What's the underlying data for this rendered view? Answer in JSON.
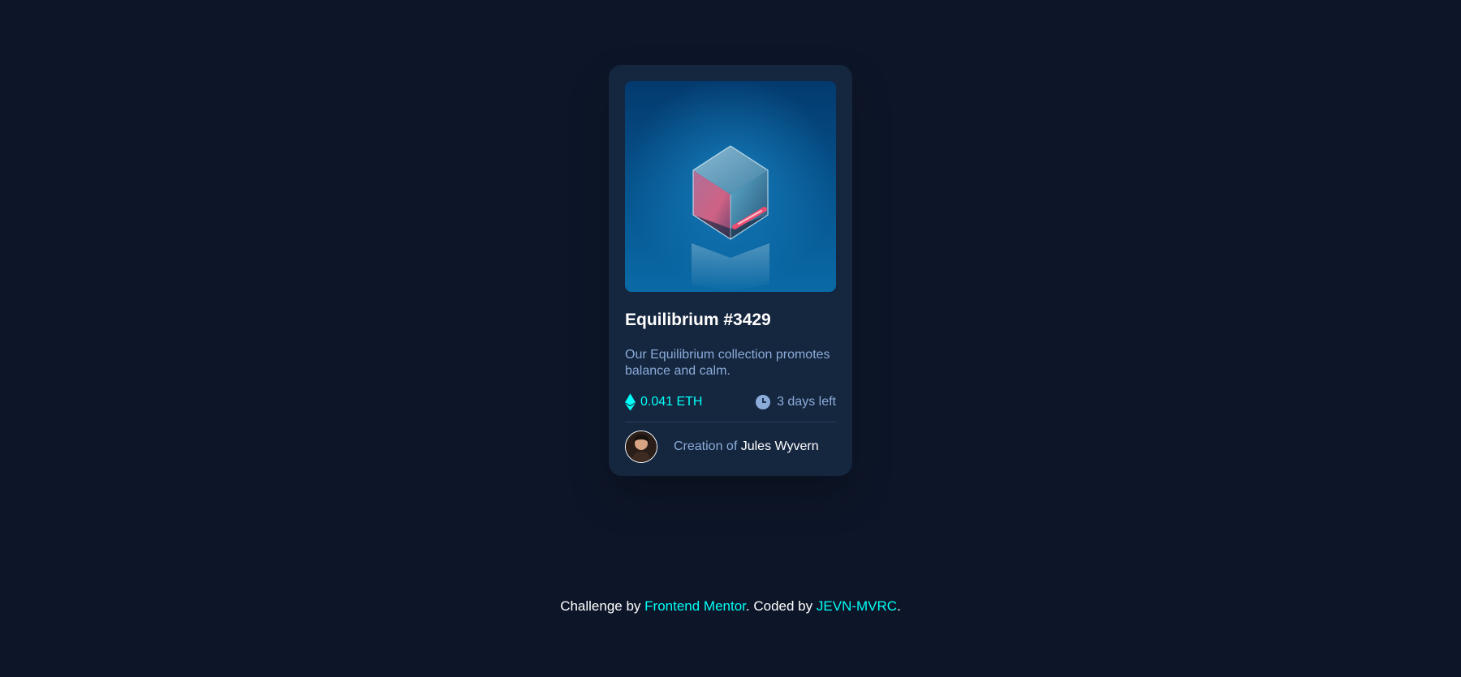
{
  "card": {
    "title": "Equilibrium #3429",
    "description": "Our Equilibrium collection promotes balance and calm.",
    "price": "0.041 ETH",
    "time_left": "3 days left",
    "creator_prefix": "Creation of",
    "creator_name": "Jules Wyvern",
    "icons": {
      "price": "ethereum-icon",
      "time": "clock-icon"
    }
  },
  "footer": {
    "prefix": "Challenge by",
    "link1": "Frontend Mentor",
    "middle": ". Coded by",
    "link2": "JEVN-MVRC",
    "suffix": "."
  },
  "colors": {
    "page_bg": "#0d1628",
    "card_bg": "#15263f",
    "accent": "#00fff8",
    "muted": "#8bacd9",
    "white": "#ffffff"
  }
}
